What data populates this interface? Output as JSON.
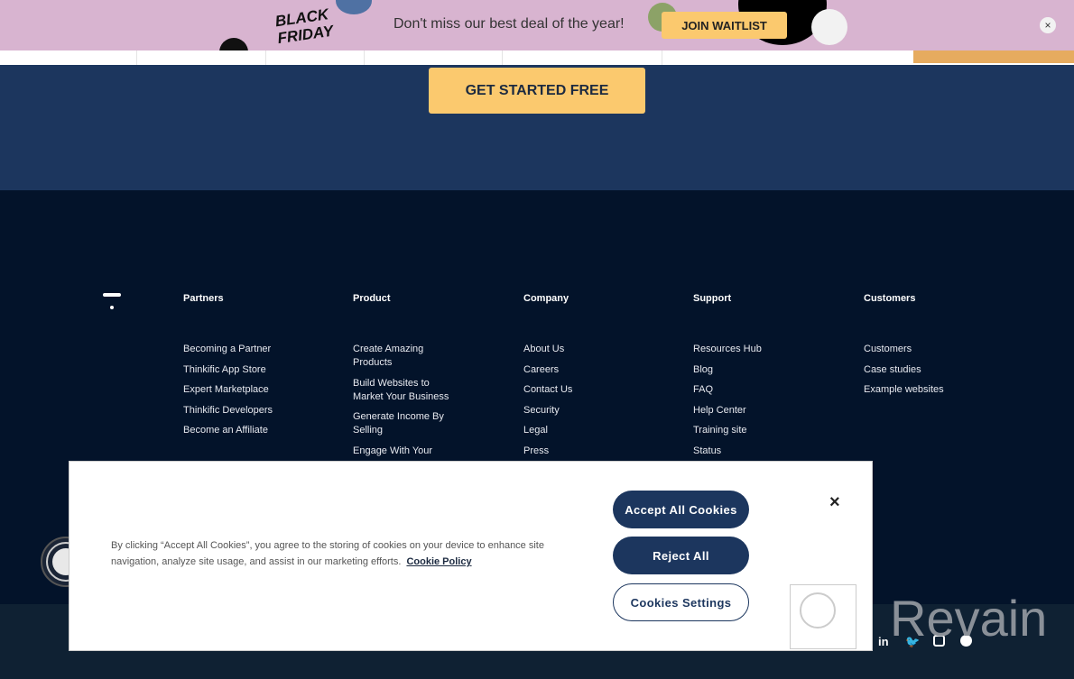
{
  "banner": {
    "logo_text": [
      "BLACK",
      "FRIDAY"
    ],
    "message": "Don't miss our best deal of the year!",
    "cta": "JOIN WAITLIST",
    "close": "×"
  },
  "hero": {
    "cta": "GET STARTED FREE"
  },
  "footer": {
    "columns": [
      {
        "title": "Partners",
        "items": [
          "Becoming a Partner",
          "Thinkific App Store",
          "Expert Marketplace",
          "Thinkific Developers",
          "Become an Affiliate"
        ]
      },
      {
        "title": "Product",
        "items": [
          "Create Amazing Products",
          "Build Websites to Market Your Business",
          "Generate Income By Selling",
          "Engage With Your"
        ]
      },
      {
        "title": "Company",
        "items": [
          "About Us",
          "Careers",
          "Contact Us",
          "Security",
          "Legal",
          "Press"
        ]
      },
      {
        "title": "Support",
        "items": [
          "Resources Hub",
          "Blog",
          "FAQ",
          "Help Center",
          "Training site",
          "Status"
        ]
      },
      {
        "title": "Customers",
        "items": [
          "Customers",
          "Case studies",
          "Example websites"
        ]
      }
    ],
    "social": [
      "in",
      "twitter-icon",
      "instagram-icon",
      "pinterest-icon"
    ]
  },
  "cookie_banner": {
    "text": "By clicking “Accept All Cookies”, you agree to the storing of cookies on your device to enhance site navigation, analyze site usage, and assist in our marketing efforts.",
    "policy_link": "Cookie Policy",
    "accept": "Accept All Cookies",
    "reject": "Reject All",
    "settings": "Cookies Settings",
    "close": "×"
  },
  "watermark": "Revain"
}
